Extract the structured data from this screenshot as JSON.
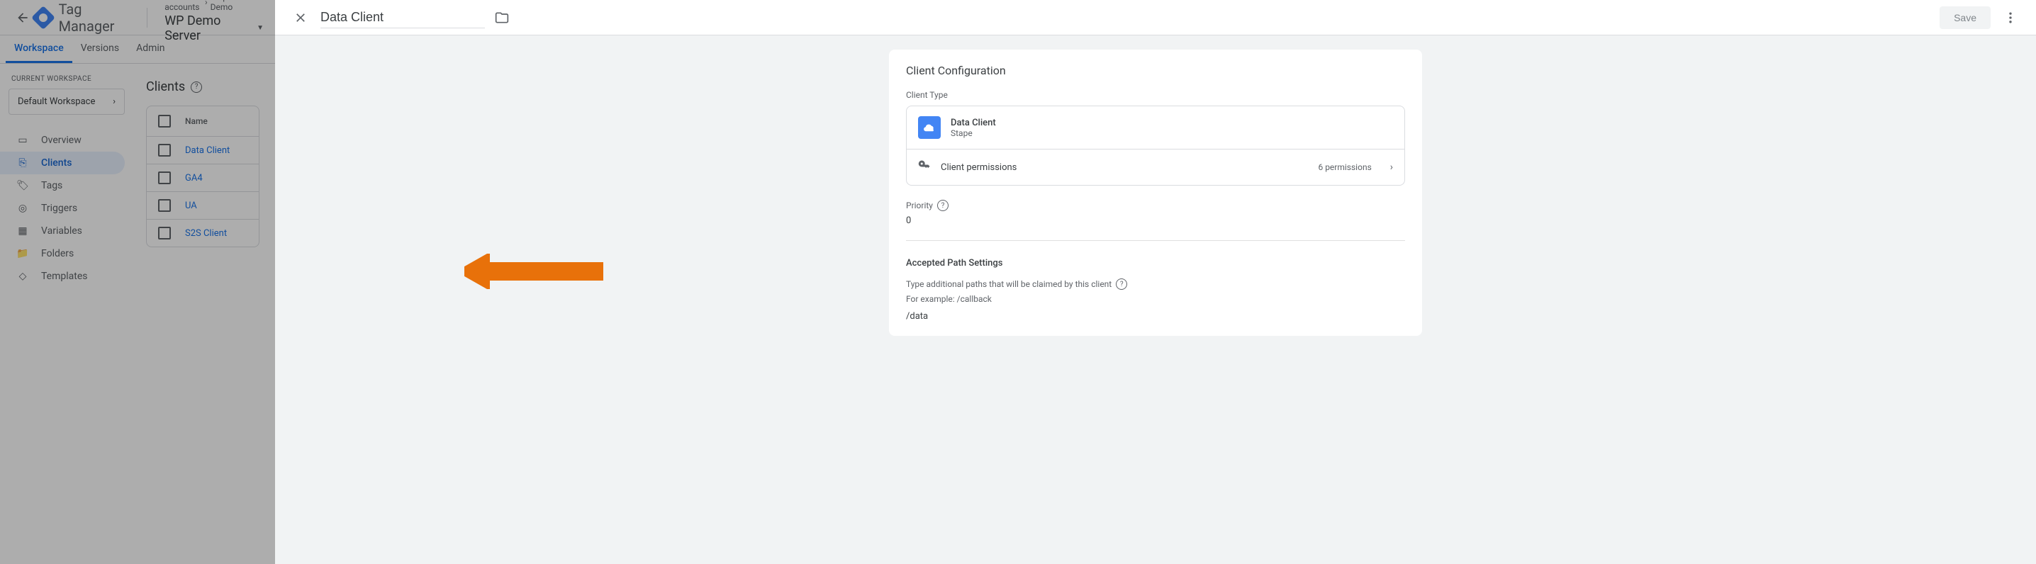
{
  "header": {
    "product": "Tag Manager",
    "breadcrumb": {
      "all": "All accounts",
      "account": "Stape GTM Demo"
    },
    "container": "WP Demo Server"
  },
  "tabs": {
    "workspace": "Workspace",
    "versions": "Versions",
    "admin": "Admin"
  },
  "sidebar": {
    "current_label": "CURRENT WORKSPACE",
    "workspace": "Default Workspace",
    "items": {
      "overview": "Overview",
      "clients": "Clients",
      "tags": "Tags",
      "triggers": "Triggers",
      "variables": "Variables",
      "folders": "Folders",
      "templates": "Templates"
    }
  },
  "list": {
    "title": "Clients",
    "col_name": "Name",
    "rows": [
      "Data Client",
      "GA4",
      "UA",
      "S2S Client"
    ]
  },
  "panel": {
    "title": "Data Client",
    "save": "Save",
    "card_title": "Client Configuration",
    "client_type_label": "Client Type",
    "type": {
      "name": "Data Client",
      "vendor": "Stape"
    },
    "permissions": {
      "label": "Client permissions",
      "count": "6 permissions"
    },
    "priority": {
      "label": "Priority",
      "value": "0"
    },
    "paths": {
      "section": "Accepted Path Settings",
      "desc": "Type additional paths that will be claimed by this client",
      "example": "For example: /callback",
      "value": "/data"
    }
  }
}
